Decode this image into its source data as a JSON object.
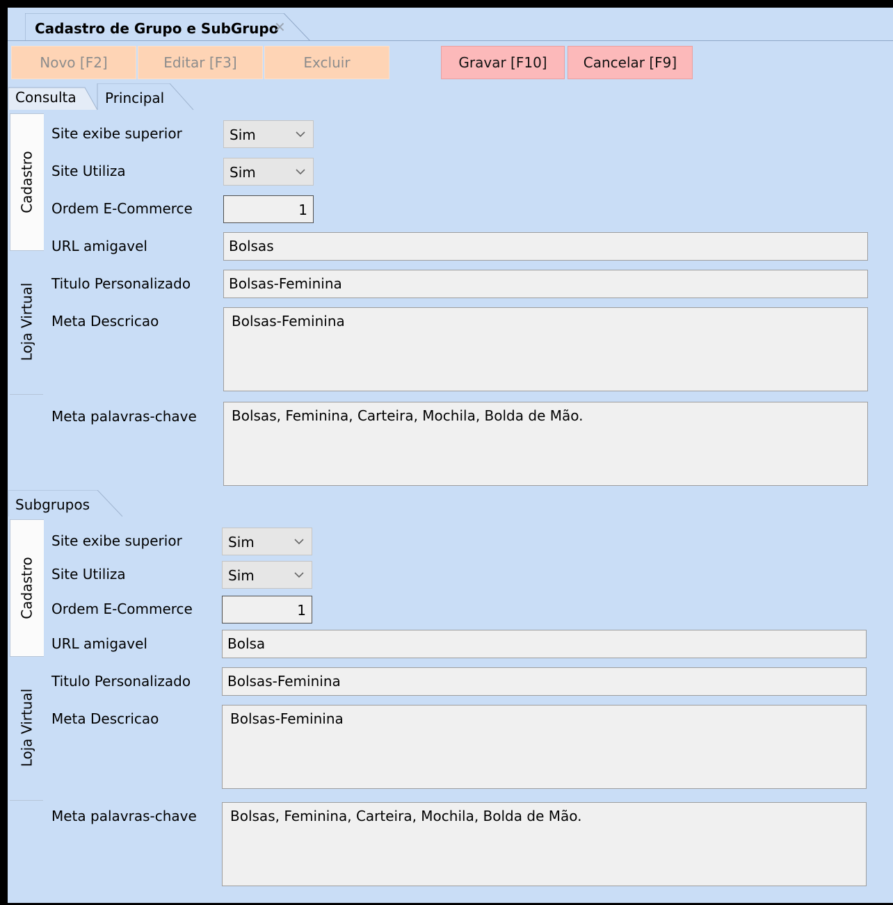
{
  "window_tab": {
    "title": "Cadastro de Grupo e SubGrupo",
    "close_glyph": "✕"
  },
  "toolbar": {
    "novo": "Novo [F2]",
    "editar": "Editar [F3]",
    "excluir": "Excluir",
    "gravar": "Gravar [F10]",
    "cancelar": "Cancelar [F9]"
  },
  "tabs": {
    "consulta": "Consulta",
    "principal": "Principal"
  },
  "principal": {
    "vtab_cadastro": "Cadastro",
    "vtab_loja": "Loja Virtual",
    "labels": {
      "site_exibe_superior": "Site exibe superior",
      "site_utiliza": "Site Utiliza",
      "ordem": "Ordem E-Commerce",
      "url": "URL amigavel",
      "titulo": "Titulo Personalizado",
      "meta_descricao": "Meta Descricao",
      "meta_palavras": "Meta palavras-chave"
    },
    "values": {
      "site_exibe_superior": "Sim",
      "site_utiliza": "Sim",
      "ordem": "1",
      "url": "Bolsas",
      "titulo": "Bolsas-Feminina",
      "meta_descricao": "Bolsas-Feminina",
      "meta_palavras": "Bolsas, Feminina, Carteira, Mochila, Bolda de Mão."
    }
  },
  "subgrupos": {
    "tab_label": "Subgrupos",
    "vtab_cadastro": "Cadastro",
    "vtab_loja": "Loja Virtual",
    "labels": {
      "site_exibe_superior": "Site exibe superior",
      "site_utiliza": "Site Utiliza",
      "ordem": "Ordem E-Commerce",
      "url": "URL amigavel",
      "titulo": "Titulo Personalizado",
      "meta_descricao": "Meta Descricao",
      "meta_palavras": "Meta palavras-chave"
    },
    "values": {
      "site_exibe_superior": "Sim",
      "site_utiliza": "Sim",
      "ordem": "1",
      "url": "Bolsa",
      "titulo": "Bolsas-Feminina",
      "meta_descricao": "Bolsas-Feminina",
      "meta_palavras": "Bolsas, Feminina, Carteira, Mochila, Bolda de Mão."
    }
  },
  "colors": {
    "background": "#c9ddf6",
    "button_disabled": "#fed4b5",
    "button_active": "#fcb9ba"
  }
}
